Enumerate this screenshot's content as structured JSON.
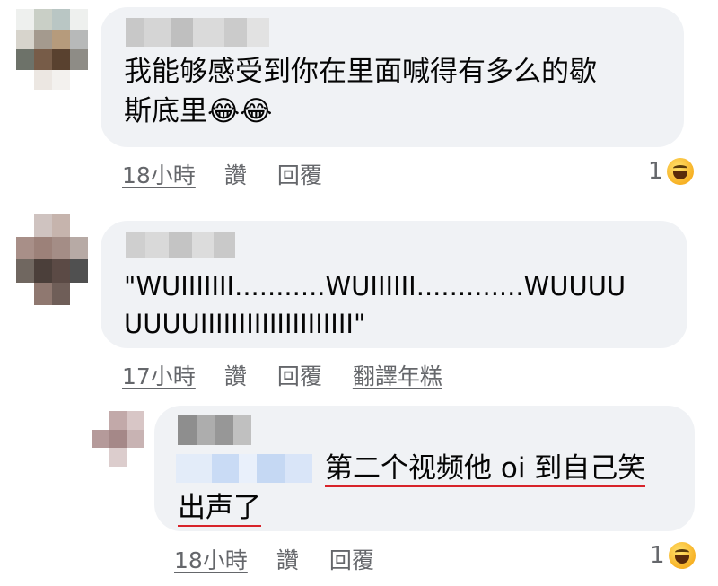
{
  "comments": [
    {
      "text_lines": [
        "我能够感受到你在里面喊得有多么的歇",
        "斯底里"
      ],
      "emoji": "😂😂",
      "time": "18小時",
      "like": "讚",
      "reply": "回覆",
      "reaction_count": "1",
      "reaction_icon": "haha-icon"
    },
    {
      "text_lines": [
        "\"WUIIIIIII...........WUIIIIII.............WUUUU",
        "UUUUIIIIIIIIIIIIIIIIIIII\""
      ],
      "time": "17小時",
      "like": "讚",
      "reply": "回覆",
      "translate": "翻譯年糕"
    },
    {
      "text_line1": "第二个视频他 oi 到自己笑",
      "text_line2": "出声了",
      "time": "18小時",
      "like": "讚",
      "reply": "回覆",
      "reaction_count": "1",
      "reaction_icon": "haha-icon"
    }
  ],
  "colors": {
    "bubble": "#f0f2f5",
    "meta": "#65676b",
    "underline_red": "#d8232a",
    "mention_blue": "#d7e6fb"
  }
}
